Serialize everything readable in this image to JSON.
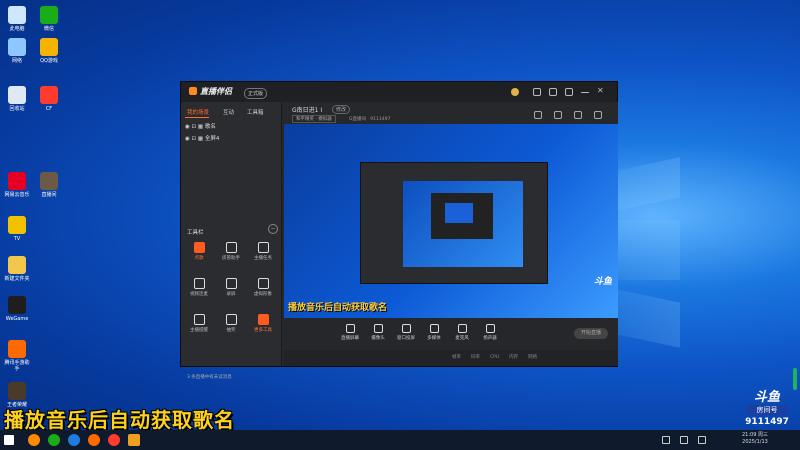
{
  "desktop": {
    "icons": [
      {
        "label": "此电脑",
        "icon": "computer-icon",
        "color": "#cfe6ff"
      },
      {
        "label": "微信",
        "icon": "wechat-icon",
        "color": "#1aad19"
      },
      {
        "label": "网络",
        "icon": "network-icon",
        "color": "#8fc7ff"
      },
      {
        "label": "QQ游戏",
        "icon": "qq-game-icon",
        "color": "#f4b400"
      },
      {
        "label": "回收站",
        "icon": "recycle-bin-icon",
        "color": "#dfe8f5"
      },
      {
        "label": "CF",
        "icon": "crossfire-icon",
        "color": "#ff3b2f"
      },
      {
        "label": "网易云音乐",
        "icon": "netease-music-icon",
        "color": "#e60026"
      },
      {
        "label": "直播间",
        "icon": "game-icon",
        "color": "#6b5a45"
      },
      {
        "label": "TV",
        "icon": "yellow-face-icon",
        "color": "#f2c200"
      },
      {
        "label": "新建文件夹",
        "icon": "folder-icon",
        "color": "#f3c64c"
      },
      {
        "label": "WeGame",
        "icon": "wegame-icon",
        "color": "#1e1e1e"
      },
      {
        "label": "腾讯手游助手",
        "icon": "tencent-emulator-icon",
        "color": "#ff6a00"
      },
      {
        "label": "王者荣耀",
        "icon": "hero-icon",
        "color": "#4a3a2a"
      }
    ]
  },
  "obs": {
    "logo": "直播伴侣",
    "version": "正式版",
    "left_tabs": [
      "我的场景",
      "互动",
      "工具箱"
    ],
    "sources": [
      "歌名",
      "全屏4"
    ],
    "tools_heading": "工具栏",
    "tools": [
      {
        "label": "点歌",
        "icon": "music-icon",
        "hot": true
      },
      {
        "label": "房管助手",
        "icon": "user-icon",
        "hot": false
      },
      {
        "label": "主播任务",
        "icon": "task-icon",
        "hot": false
      },
      {
        "label": "视频连麦",
        "icon": "video-icon",
        "hot": false
      },
      {
        "label": "录屏",
        "icon": "download-icon",
        "hot": false
      },
      {
        "label": "虚拟形象",
        "icon": "avatar-icon",
        "hot": false
      },
      {
        "label": "主播提醒",
        "icon": "bell-icon",
        "hot": false
      },
      {
        "label": "抽奖",
        "icon": "gift-icon",
        "hot": false
      },
      {
        "label": "更多工具",
        "icon": "grid-icon",
        "hot": true
      }
    ],
    "footer_tip": "3 条直播中有未读消息",
    "room_name": "G南日进1 I",
    "room_edit": "修改",
    "category": "和平精英 · 模拟器",
    "room_id": "G直播间 · 9111497",
    "preview_caption": "播放音乐后自动获取歌名",
    "preview_watermark": "斗鱼",
    "controls": [
      {
        "label": "直播屏幕",
        "icon": "monitor-icon"
      },
      {
        "label": "摄像头",
        "icon": "camera-icon"
      },
      {
        "label": "窗口投屏",
        "icon": "window-icon"
      },
      {
        "label": "多媒体",
        "icon": "media-icon"
      },
      {
        "label": "麦克风",
        "icon": "mic-icon"
      },
      {
        "label": "扬声器",
        "icon": "speaker-icon"
      }
    ],
    "start_button": "开始直播",
    "status_items": [
      "帧率",
      "码率",
      "CPU",
      "内存",
      "网络"
    ]
  },
  "overlay": {
    "caption": "播放音乐后自动获取歌名",
    "badge_logo": "斗鱼",
    "badge_label": "房间号",
    "room_number": "9111497"
  },
  "taskbar": {
    "clock_time": "21:09 周三",
    "clock_date": "2025/1/13"
  },
  "colors": {
    "accent": "#ff6a2e",
    "caption": "#ffd21a"
  }
}
